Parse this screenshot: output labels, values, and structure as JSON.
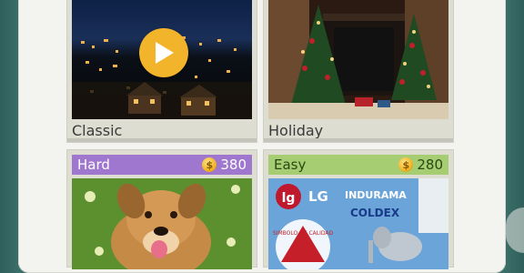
{
  "levels": [
    {
      "name": "Classic"
    },
    {
      "name": "Holiday"
    }
  ],
  "packs": [
    {
      "difficulty": "Hard",
      "price": "380"
    },
    {
      "difficulty": "Easy",
      "price": "280"
    }
  ],
  "easy_pack_logos": {
    "lg": "LG",
    "indurama": "INDURAMA",
    "coldex": "COLDEX",
    "seal": "SIMBOLO DE CALIDAD"
  },
  "colors": {
    "hard_header": "#9f77cf",
    "easy_header": "#a7cd72",
    "coin": "#f2b525",
    "play_button": "#f2b42a"
  },
  "icons": [
    "play-icon",
    "coin-icon"
  ]
}
